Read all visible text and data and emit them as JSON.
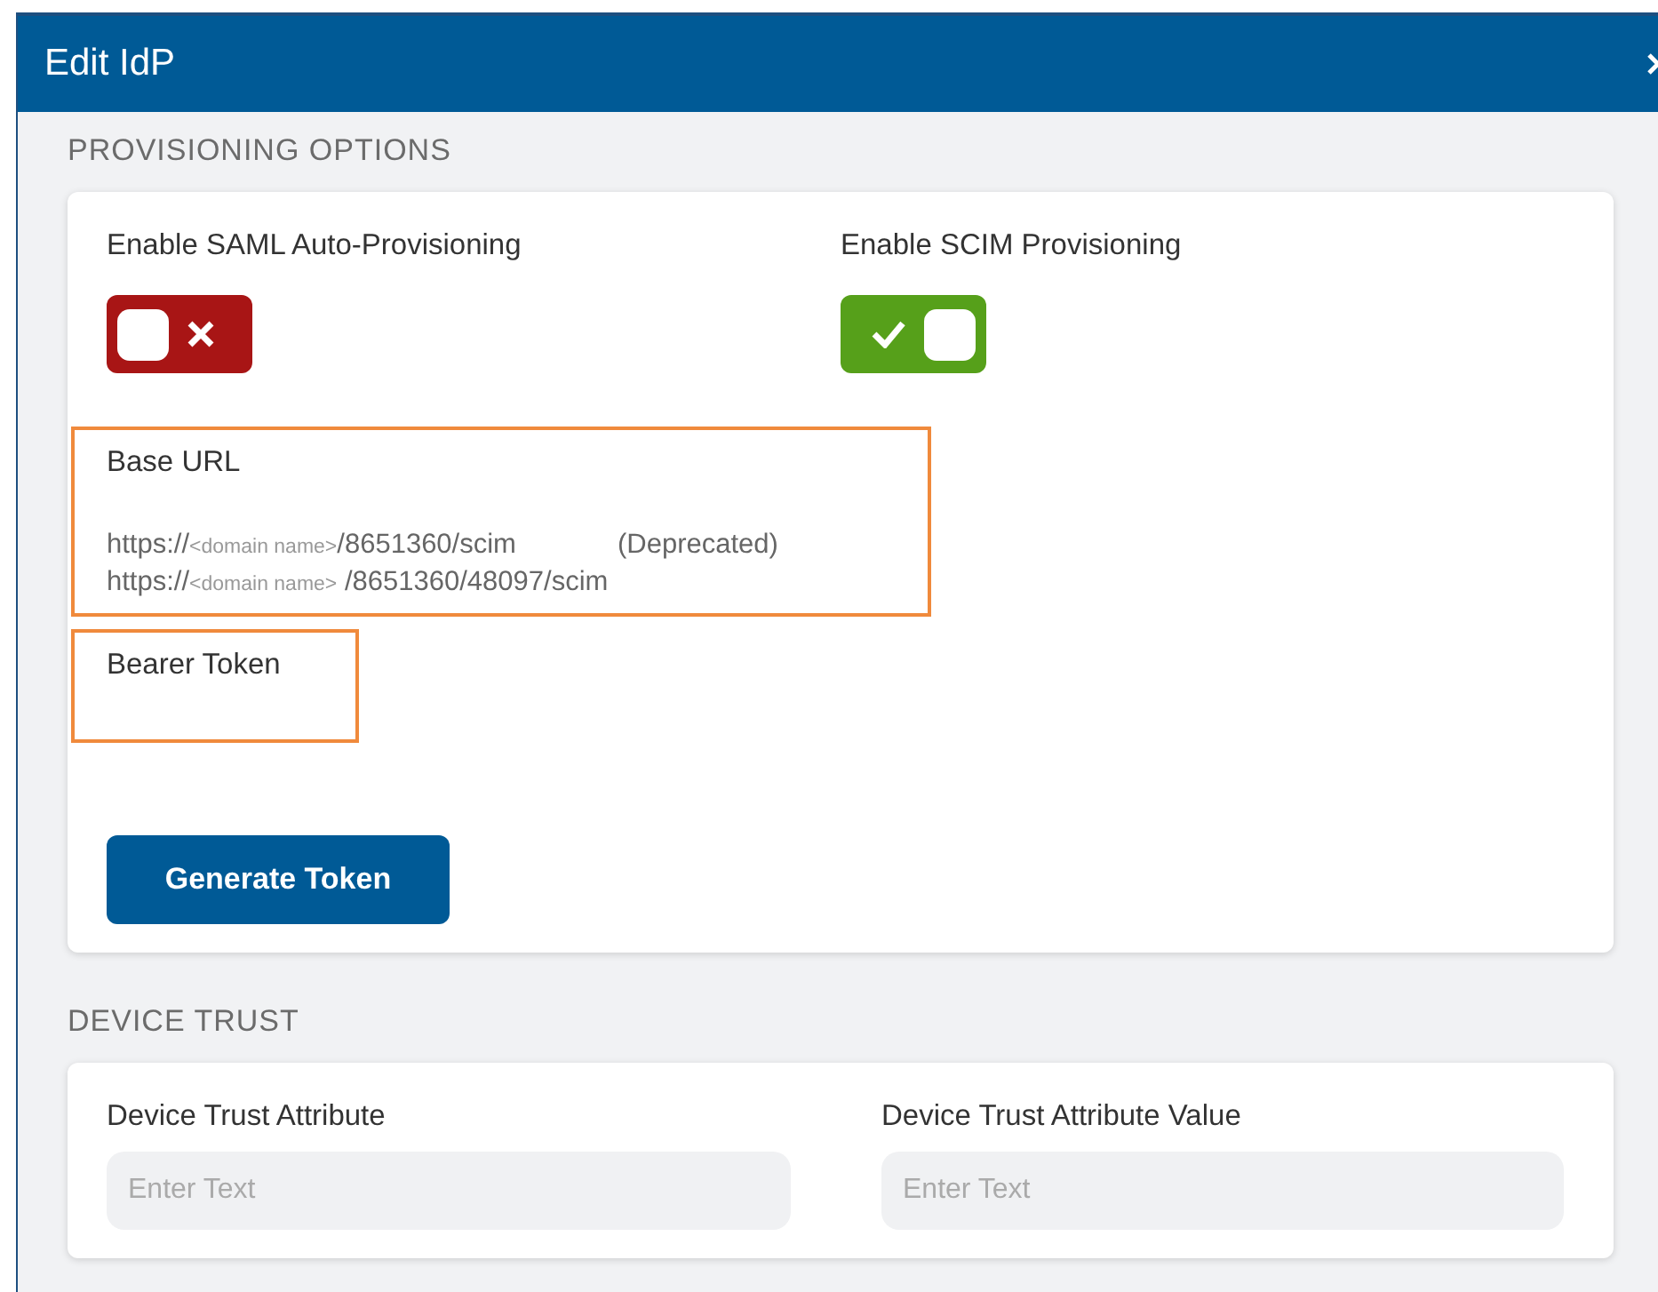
{
  "window": {
    "title": "Edit IdP"
  },
  "sections": [
    {
      "kind": "provisioning",
      "title": "PROVISIONING OPTIONS",
      "toggles": [
        {
          "label": "Enable SAML Auto-Provisioning",
          "on": false
        },
        {
          "label": "Enable SCIM Provisioning",
          "on": true
        }
      ],
      "base_url": {
        "label": "Base URL",
        "highlighted": true,
        "lines": [
          {
            "prefix": "https://",
            "placeholder": "<domain name>",
            "path": "/8651360/scim",
            "note": "(Deprecated)"
          },
          {
            "prefix": "https://",
            "placeholder": "<domain name>",
            "path": " /8651360/48097/scim"
          }
        ]
      },
      "bearer_token": {
        "label": "Bearer Token",
        "highlighted": true
      },
      "button": "Generate Token"
    },
    {
      "kind": "fields",
      "title": "DEVICE TRUST",
      "fields": [
        {
          "label": "Device Trust Attribute",
          "placeholder": "Enter Text"
        },
        {
          "label": "Device Trust Attribute Value",
          "placeholder": "Enter Text"
        }
      ]
    }
  ]
}
